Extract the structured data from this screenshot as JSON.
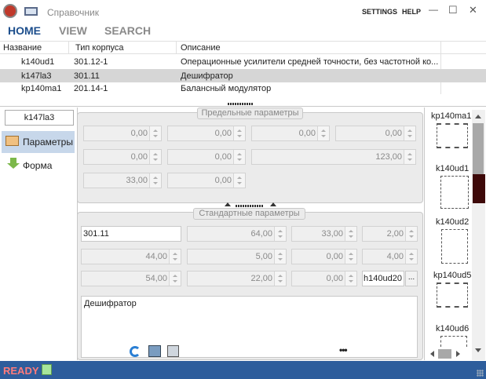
{
  "titlebar": {
    "title": "Справочник",
    "settings": "SETTINGS",
    "help": "HELP",
    "min": "—",
    "max": "☐",
    "close": "✕"
  },
  "nav": {
    "home": "HOME",
    "view": "VIEW",
    "search": "SEARCH"
  },
  "table": {
    "headers": [
      "Название",
      "Тип корпуса",
      "Описание"
    ],
    "rows": [
      [
        "k140ud1",
        "301.12-1",
        "Операционные усилители средней точности, без частотной ко..."
      ],
      [
        "k147la3",
        "301.11",
        "Дешифратор"
      ],
      [
        "kp140ma1",
        "201.14-1",
        "Балансный модулятор"
      ]
    ]
  },
  "sidebar": {
    "part": "k147la3",
    "params": "Параметры",
    "form": "Форма"
  },
  "limit": {
    "title": "Предельные параметры",
    "r1": [
      "0,00",
      "0,00",
      "0,00",
      "0,00"
    ],
    "r2": [
      "0,00",
      "0,00",
      "123,00"
    ],
    "r3": [
      "33,00",
      "0,00"
    ]
  },
  "std": {
    "title": "Стандартные параметры",
    "case": "301.11",
    "r1": [
      "64,00",
      "33,00",
      "2,00"
    ],
    "r2": [
      "44,00",
      "5,00",
      "0,00",
      "4,00"
    ],
    "r3": [
      "54,00",
      "22,00",
      "0,00"
    ],
    "analog": "h140ud20",
    "more": "...",
    "desc": "Дешифратор",
    "dots": "•••"
  },
  "thumbs": [
    "kp140ma1",
    "k140ud1",
    "k140ud2",
    "kp140ud5",
    "k140ud6"
  ],
  "status": {
    "ready": "READY"
  },
  "colors": {
    "accent": "#1c4e8c",
    "status": "#2d5d9c",
    "ready": "#ff7b7b",
    "selected": "#d6d6d6"
  }
}
